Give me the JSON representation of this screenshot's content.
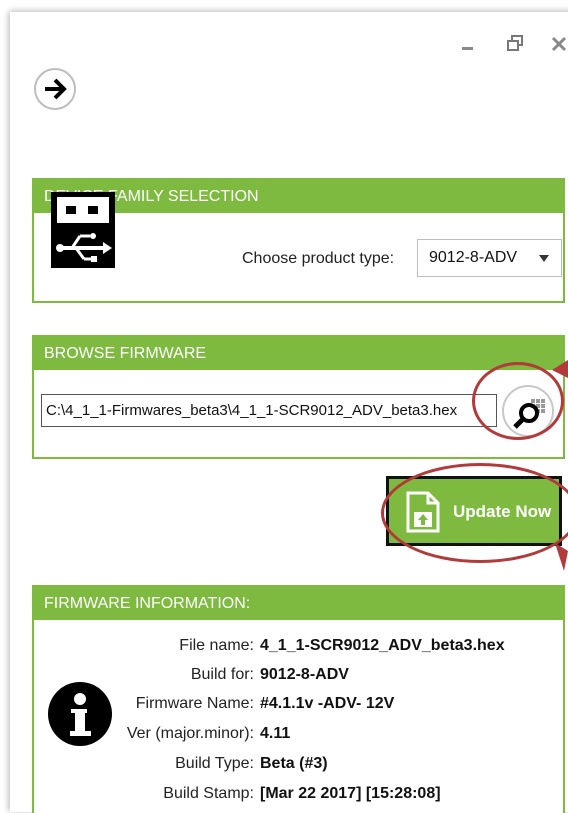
{
  "window": {
    "buttons": {
      "minimize_icon": "minimize-icon",
      "restore_icon": "restore-icon",
      "close_icon": "close-icon"
    }
  },
  "device_family": {
    "header": "DEVICE FAMILY SELECTION",
    "choose_label": "Choose product type:",
    "selected_product": "9012-8-ADV"
  },
  "browse_firmware": {
    "header": "BROWSE FIRMWARE",
    "path_value": "C:\\4_1_1-Firmwares_beta3\\4_1_1-SCR9012_ADV_beta3.hex"
  },
  "update_button": {
    "label": "Update Now"
  },
  "firmware_info": {
    "header": "FIRMWARE INFORMATION:",
    "rows": [
      {
        "label": "File name:",
        "value": "4_1_1-SCR9012_ADV_beta3.hex"
      },
      {
        "label": "Build for:",
        "value": "9012-8-ADV"
      },
      {
        "label": "Firmware Name:",
        "value": "#4.1.1v -ADV- 12V"
      },
      {
        "label": "Ver (major.minor):",
        "value": "4.11"
      },
      {
        "label": "Build Type:",
        "value": "Beta (#3)"
      },
      {
        "label": "Build Stamp:",
        "value": "[Mar 22 2017] [15:28:08]"
      }
    ]
  },
  "colors": {
    "accent": "#7dba3f",
    "annotation": "#b23a3a"
  }
}
